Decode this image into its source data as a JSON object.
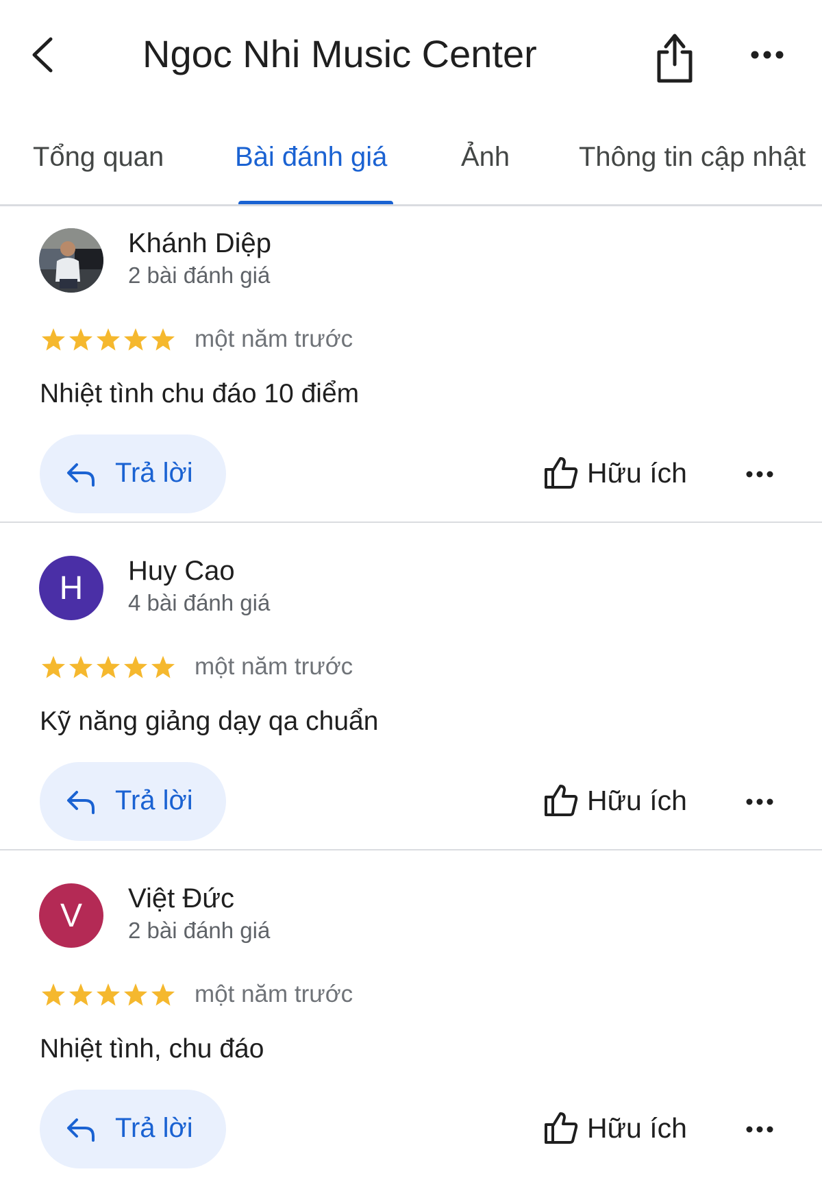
{
  "header": {
    "title": "Ngoc Nhi Music Center",
    "back_icon": "chevron-left-icon",
    "share_icon": "share-icon",
    "more_icon": "more-horizontal-icon"
  },
  "tabs": [
    {
      "label": "Tổng quan",
      "active": false
    },
    {
      "label": "Bài đánh giá",
      "active": true
    },
    {
      "label": "Ảnh",
      "active": false
    },
    {
      "label": "Thông tin cập nhật",
      "active": false
    }
  ],
  "colors": {
    "accent": "#1a62d2",
    "star": "#f5b82e",
    "reply_bg": "#e9f0fd",
    "avatar_h": "#4a2fa6",
    "avatar_v": "#b42a55"
  },
  "reviews": [
    {
      "name": "Khánh Diệp",
      "count": "2 bài đánh giá",
      "avatar_type": "photo",
      "rating": 5,
      "time": "một năm trước",
      "text": "Nhiệt tình chu đáo 10 điểm",
      "reply_label": "Trả lời",
      "helpful_label": "Hữu ích"
    },
    {
      "name": "Huy Cao",
      "count": "4 bài đánh giá",
      "avatar_letter": "H",
      "rating": 5,
      "time": "một năm trước",
      "text": "Kỹ năng giảng dạy qa chuẩn",
      "reply_label": "Trả lời",
      "helpful_label": "Hữu ích"
    },
    {
      "name": "Việt Đức",
      "count": "2 bài đánh giá",
      "avatar_letter": "V",
      "rating": 5,
      "time": "một năm trước",
      "text": "Nhiệt tình, chu đáo",
      "reply_label": "Trả lời",
      "helpful_label": "Hữu ích"
    }
  ]
}
